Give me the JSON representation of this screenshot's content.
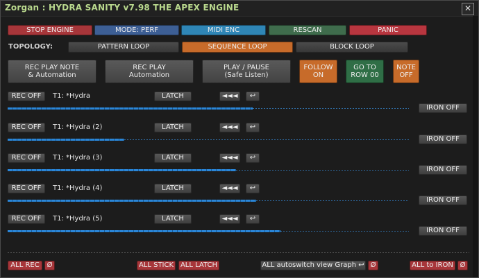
{
  "title": "Zorgan : HYDRA SANITY v7.98 THE APEX ENGINE",
  "close_glyph": "✕",
  "toolbar": [
    {
      "label": "STOP ENGINE",
      "color": "#a7363a"
    },
    {
      "label": "MODE: PERF",
      "color": "#3d5f95"
    },
    {
      "label": "MIDI ENC",
      "color": "#2f86b6"
    },
    {
      "label": "RESCAN",
      "color": "#3f6c4c"
    },
    {
      "label": "PANIC",
      "color": "#b8363f"
    }
  ],
  "topology": {
    "label": "TOPOLOGY:",
    "options": [
      "PATTERN LOOP",
      "SEQUENCE LOOP",
      "BLOCK LOOP"
    ],
    "active": "SEQUENCE LOOP",
    "active_color": "#c76b2a"
  },
  "actions": {
    "rec_play_note": [
      "REC PLAY NOTE",
      "& Automation"
    ],
    "rec_play": [
      "REC PLAY",
      "Automation"
    ],
    "play_pause": [
      "PLAY / PAUSE",
      "(Safe Listen)"
    ],
    "follow": [
      "FOLLOW",
      "ON"
    ],
    "go_to_row": [
      "GO TO",
      "ROW 00"
    ],
    "note_off": [
      "NOTE",
      "OFF"
    ],
    "orange": "#c76b2a",
    "green": "#2f6e46"
  },
  "tracks": [
    {
      "rec": "REC OFF",
      "name": "T1: *Hydra",
      "latch": "LATCH",
      "rew": "◄◄◄",
      "ret": "↩",
      "iron": "IRON OFF",
      "progress": 0.61
    },
    {
      "rec": "REC OFF",
      "name": "T1: *Hydra (2)",
      "latch": "LATCH",
      "rew": "◄◄◄",
      "ret": "↩",
      "iron": "IRON OFF",
      "progress": 0.29
    },
    {
      "rec": "REC OFF",
      "name": "T1: *Hydra (3)",
      "latch": "LATCH",
      "rew": "◄◄◄",
      "ret": "↩",
      "iron": "IRON OFF",
      "progress": 0.57
    },
    {
      "rec": "REC OFF",
      "name": "T1: *Hydra (4)",
      "latch": "LATCH",
      "rew": "◄◄◄",
      "ret": "↩",
      "iron": "IRON OFF",
      "progress": 0.62
    },
    {
      "rec": "REC OFF",
      "name": "T1: *Hydra (5)",
      "latch": "LATCH",
      "rew": "◄◄◄",
      "ret": "↩",
      "iron": "IRON OFF",
      "progress": 0.68
    }
  ],
  "footer": {
    "all_rec": "ALL REC",
    "null1": "Ø",
    "all_stick": "ALL STICK",
    "all_latch": "ALL LATCH",
    "autoswitch": "ALL autoswitch view Graph ↩",
    "null2": "Ø",
    "all_to_iron": "ALL to IRON",
    "null3": "Ø",
    "red": "#a7363a"
  }
}
